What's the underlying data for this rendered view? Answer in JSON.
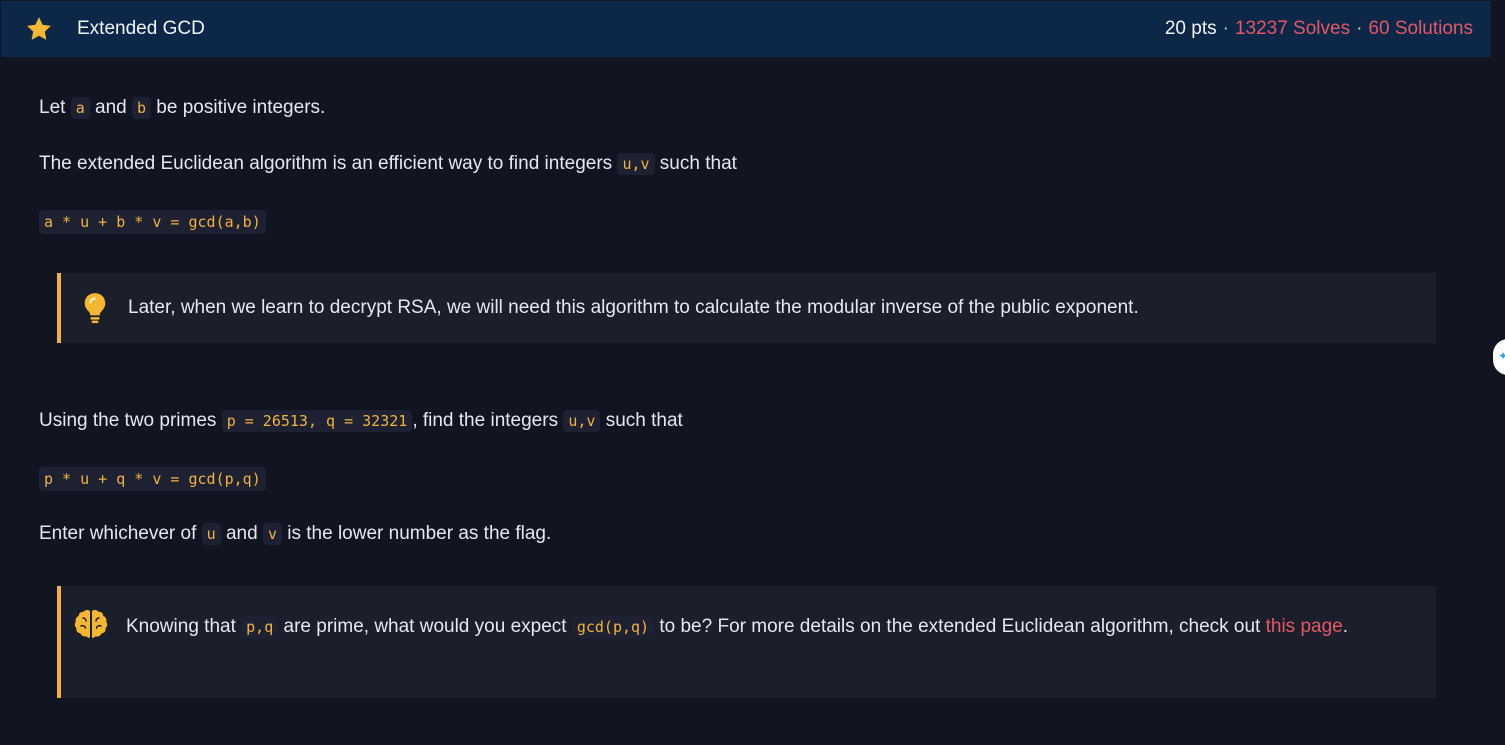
{
  "header": {
    "title": "Extended GCD",
    "points": "20 pts",
    "separator": "·",
    "solves": "13237 Solves",
    "solutions": "60 Solutions"
  },
  "content": {
    "line1": {
      "t1": "Let ",
      "c1": "a",
      "t2": " and ",
      "c2": "b",
      "t3": " be positive integers."
    },
    "line2": {
      "t1": "The extended Euclidean algorithm is an efficient way to find integers ",
      "c1": "u,v",
      "t2": " such that"
    },
    "equation1": "a * u + b * v = gcd(a,b)",
    "callout1_text": "Later, when we learn to decrypt RSA, we will need this algorithm to calculate the modular inverse of the public exponent.",
    "line3": {
      "t1": "Using the two primes ",
      "c1": "p = 26513, q = 32321",
      "t2": ", find the integers ",
      "c2": "u,v",
      "t3": " such that"
    },
    "equation2": "p * u + q * v = gcd(p,q)",
    "line4": {
      "t1": "Enter whichever of ",
      "c1": "u",
      "t2": " and ",
      "c2": "v",
      "t3": " is the lower number as the flag."
    },
    "callout2": {
      "t1": "Knowing that ",
      "c1": "p,q",
      "t2": " are prime, what would you expect ",
      "c2": "gcd(p,q)",
      "t3": " to be? For more details on the extended Euclidean algorithm, check out ",
      "link": "this page",
      "t4": "."
    }
  },
  "icons": {
    "star": "star-icon",
    "bulb": "lightbulb-icon",
    "brain": "brain-icon"
  },
  "colors": {
    "accent": "#f2b33d",
    "link": "#e45866",
    "header_bg": "#0c2748",
    "page_bg": "#111421"
  }
}
